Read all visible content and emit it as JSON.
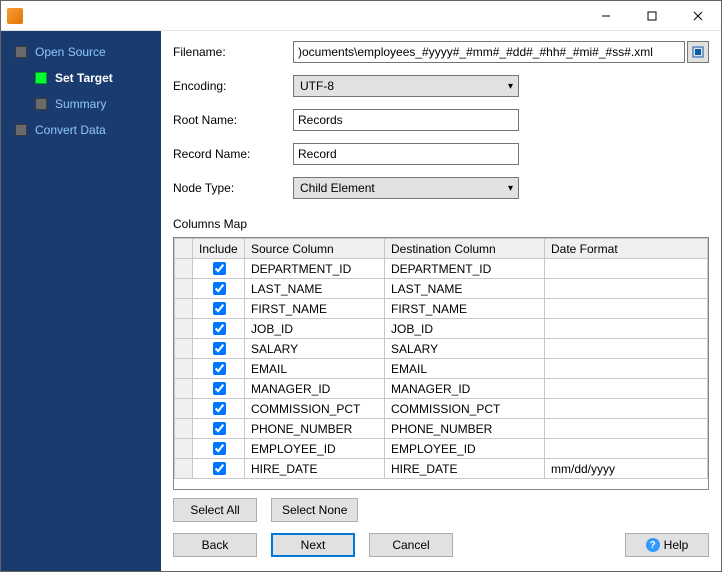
{
  "sidebar": {
    "items": [
      {
        "label": "Open Source",
        "active": false,
        "indent": false
      },
      {
        "label": "Set Target",
        "active": true,
        "indent": true
      },
      {
        "label": "Summary",
        "active": false,
        "indent": true
      },
      {
        "label": "Convert Data",
        "active": false,
        "indent": false
      }
    ]
  },
  "form": {
    "filename_label": "Filename:",
    "filename_value": ")ocuments\\employees_#yyyy#_#mm#_#dd#_#hh#_#mi#_#ss#.xml",
    "encoding_label": "Encoding:",
    "encoding_value": "UTF-8",
    "rootname_label": "Root Name:",
    "rootname_value": "Records",
    "recordname_label": "Record Name:",
    "recordname_value": "Record",
    "nodetype_label": "Node Type:",
    "nodetype_value": "Child Element"
  },
  "columns": {
    "section_label": "Columns Map",
    "headers": {
      "include": "Include",
      "source": "Source Column",
      "destination": "Destination Column",
      "date_format": "Date Format"
    },
    "rows": [
      {
        "include": true,
        "source": "DEPARTMENT_ID",
        "destination": "DEPARTMENT_ID",
        "date_format": ""
      },
      {
        "include": true,
        "source": "LAST_NAME",
        "destination": "LAST_NAME",
        "date_format": ""
      },
      {
        "include": true,
        "source": "FIRST_NAME",
        "destination": "FIRST_NAME",
        "date_format": ""
      },
      {
        "include": true,
        "source": "JOB_ID",
        "destination": "JOB_ID",
        "date_format": ""
      },
      {
        "include": true,
        "source": "SALARY",
        "destination": "SALARY",
        "date_format": ""
      },
      {
        "include": true,
        "source": "EMAIL",
        "destination": "EMAIL",
        "date_format": ""
      },
      {
        "include": true,
        "source": "MANAGER_ID",
        "destination": "MANAGER_ID",
        "date_format": ""
      },
      {
        "include": true,
        "source": "COMMISSION_PCT",
        "destination": "COMMISSION_PCT",
        "date_format": ""
      },
      {
        "include": true,
        "source": "PHONE_NUMBER",
        "destination": "PHONE_NUMBER",
        "date_format": ""
      },
      {
        "include": true,
        "source": "EMPLOYEE_ID",
        "destination": "EMPLOYEE_ID",
        "date_format": ""
      },
      {
        "include": true,
        "source": "HIRE_DATE",
        "destination": "HIRE_DATE",
        "date_format": "mm/dd/yyyy"
      }
    ]
  },
  "buttons": {
    "select_all": "Select All",
    "select_none": "Select None",
    "back": "Back",
    "next": "Next",
    "cancel": "Cancel",
    "help": "Help"
  }
}
